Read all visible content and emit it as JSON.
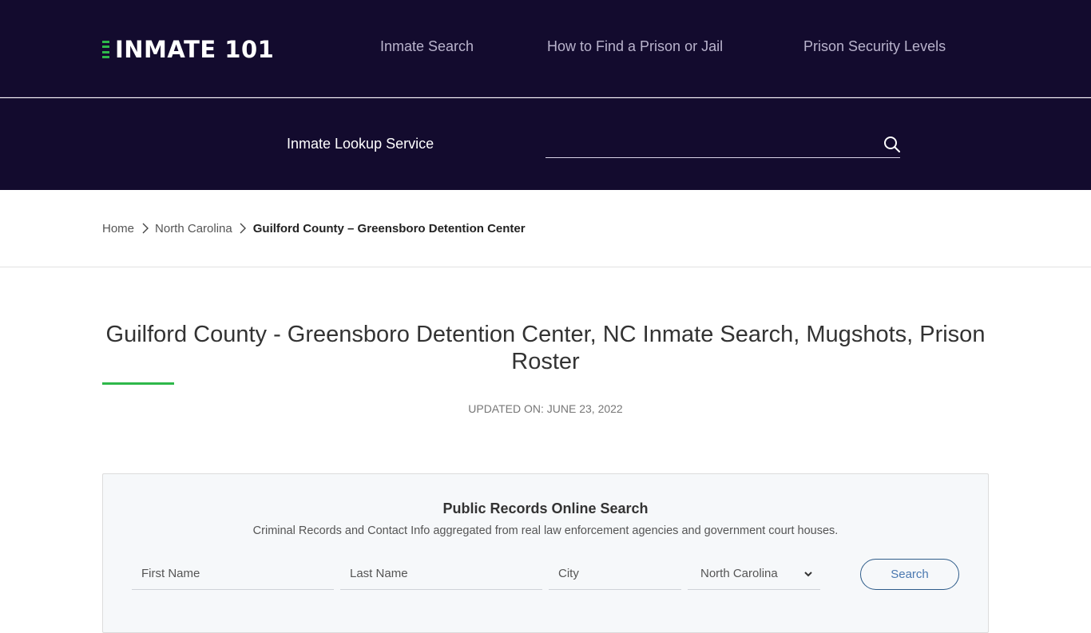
{
  "header": {
    "logo_text": "INMATE 101",
    "nav": [
      {
        "label": "Inmate Search"
      },
      {
        "label": "How to Find a Prison or Jail"
      },
      {
        "label": "Prison Security Levels"
      }
    ]
  },
  "lookup": {
    "label": "Inmate Lookup Service",
    "input_value": "",
    "icon": "search-icon"
  },
  "breadcrumb": {
    "items": [
      {
        "label": "Home"
      },
      {
        "label": "North Carolina"
      },
      {
        "label": "Guilford County – Greensboro Detention Center"
      }
    ]
  },
  "page": {
    "title": "Guilford County - Greensboro Detention Center, NC Inmate Search, Mugshots, Prison Roster",
    "updated": "UPDATED ON: JUNE 23, 2022"
  },
  "records_search": {
    "title": "Public Records Online Search",
    "subtitle": "Criminal Records and Contact Info aggregated from real law enforcement agencies and government court houses.",
    "first_name_placeholder": "First Name",
    "last_name_placeholder": "Last Name",
    "city_placeholder": "City",
    "state_selected": "North Carolina",
    "button_label": "Search"
  },
  "colors": {
    "header_bg": "#130b2e",
    "accent_green": "#2eb84a",
    "button_blue": "#2e5c8a"
  }
}
